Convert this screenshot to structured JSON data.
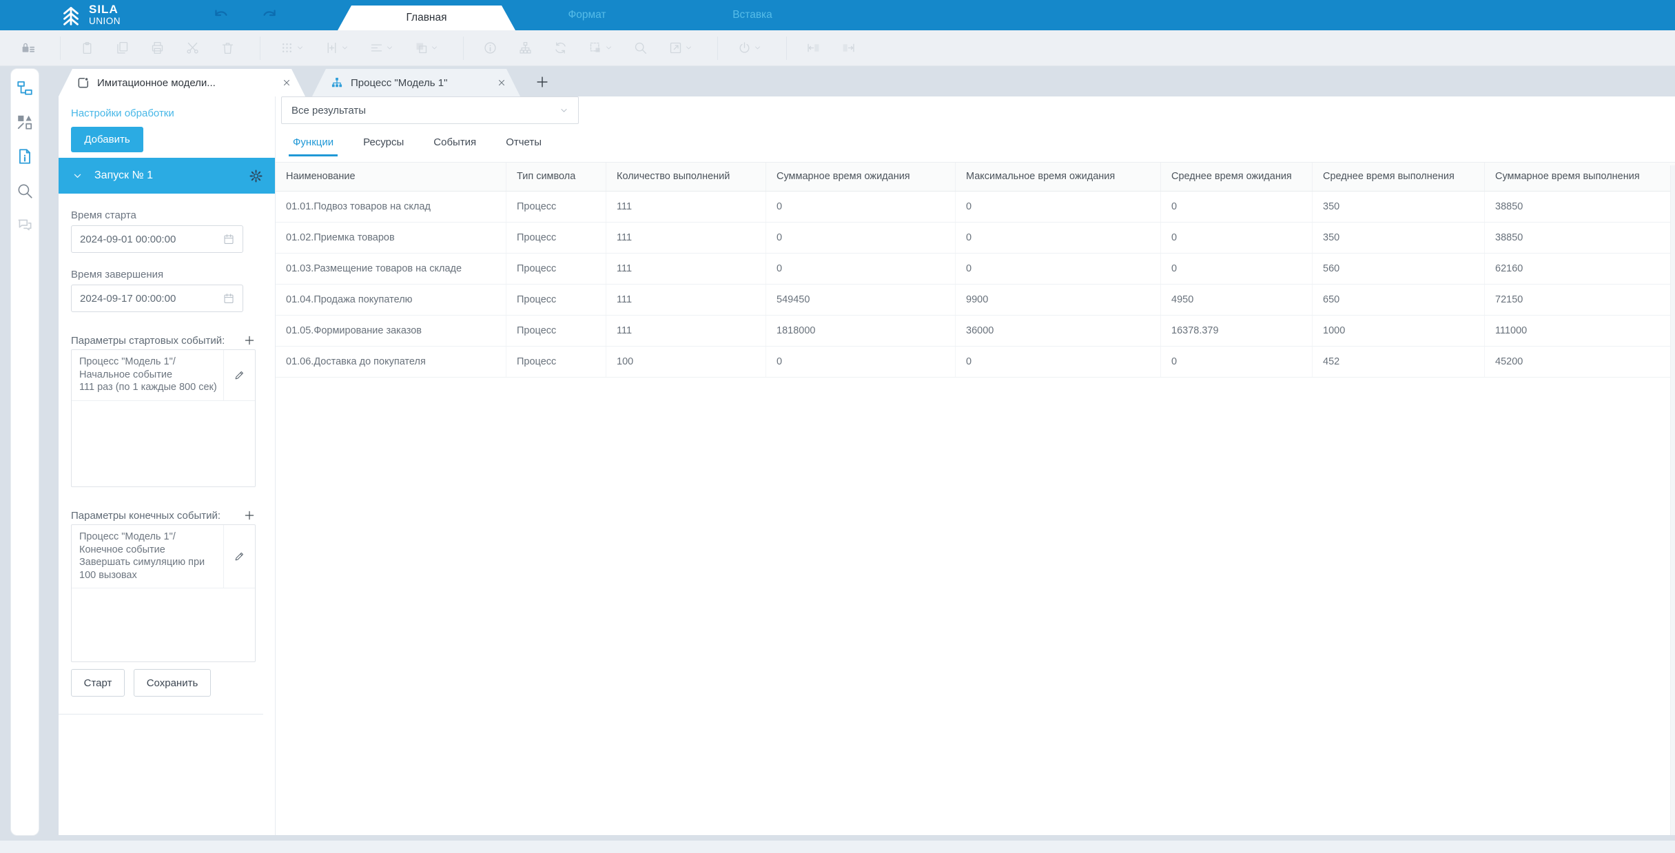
{
  "app": {
    "brand_line1": "SILA",
    "brand_line2": "UNION"
  },
  "colors": {
    "topbar_blue": "#1588ca",
    "accent_blue": "#2babe3",
    "tab_active_blue": "#2098d6",
    "link_blue": "#47b7e7"
  },
  "ribbon": {
    "tabs": [
      {
        "label": "Главная",
        "active": true
      },
      {
        "label": "Формат",
        "active": false
      },
      {
        "label": "Вставка",
        "active": false
      }
    ]
  },
  "toolbar": {
    "items": [
      {
        "icon": "lock-menu-icon",
        "enabled": true
      },
      {
        "sep": true
      },
      {
        "icon": "paste-icon"
      },
      {
        "icon": "copy-icon"
      },
      {
        "icon": "print-icon"
      },
      {
        "icon": "cut-icon"
      },
      {
        "icon": "delete-icon"
      },
      {
        "sep": true
      },
      {
        "icon": "grid-icon",
        "chevron": true
      },
      {
        "icon": "insert-symbol-icon",
        "chevron": true
      },
      {
        "icon": "align-icon",
        "chevron": true
      },
      {
        "icon": "layers-icon",
        "chevron": true
      },
      {
        "sep": true
      },
      {
        "icon": "info-icon"
      },
      {
        "icon": "hierarchy-icon"
      },
      {
        "icon": "refresh-icon"
      },
      {
        "icon": "selection-icon",
        "chevron": true
      },
      {
        "icon": "search-icon"
      },
      {
        "icon": "open-diagram-icon",
        "chevron": true
      },
      {
        "sep": true
      },
      {
        "icon": "power-icon",
        "chevron": true
      },
      {
        "sep": true
      },
      {
        "icon": "collapse-left-icon"
      },
      {
        "icon": "collapse-right-icon"
      }
    ]
  },
  "dock": {
    "items": [
      {
        "icon": "model-tree-icon"
      },
      {
        "icon": "shapes-icon"
      },
      {
        "icon": "document-info-icon"
      },
      {
        "icon": "search-icon"
      },
      {
        "icon": "comments-icon"
      }
    ]
  },
  "doc_tabs": [
    {
      "label": "Имитационное модели...",
      "icon": "report-icon",
      "active": true
    },
    {
      "label": "Процесс \"Модель 1\"",
      "icon": "org-chart-icon",
      "active": false
    }
  ],
  "panel": {
    "settings_link": "Настройки обработки",
    "add_button": "Добавить",
    "run_header": "Запуск № 1",
    "start_time_label": "Время старта",
    "start_time_value": "2024-09-01 00:00:00",
    "end_time_label": "Время завершения",
    "end_time_value": "2024-09-17 00:00:00",
    "start_events_label": "Параметры стартовых событий:",
    "start_events_text": "Процесс \"Модель 1\"/\nНачальное событие\n111 раз (по 1 каждые 800 сек)",
    "end_events_label": "Параметры конечных событий:",
    "end_events_text": "Процесс \"Модель 1\"/\nКонечное событие\nЗавершать симуляцию при 100 вызовах",
    "start_button": "Старт",
    "save_button": "Сохранить"
  },
  "results": {
    "filter_value": "Все результаты",
    "tabs": [
      "Функции",
      "Ресурсы",
      "События",
      "Отчеты"
    ],
    "active_tab": "Функции"
  },
  "table": {
    "columns": [
      "Наименование",
      "Тип символа",
      "Количество выполнений",
      "Суммарное время ожидания",
      "Максимальное время ожидания",
      "Среднее время ожидания",
      "Среднее время выполнения",
      "Суммарное время выполнения"
    ],
    "rows": [
      [
        "01.01.Подвоз товаров на склад",
        "Процесс",
        "111",
        "0",
        "0",
        "0",
        "350",
        "38850"
      ],
      [
        "01.02.Приемка товаров",
        "Процесс",
        "111",
        "0",
        "0",
        "0",
        "350",
        "38850"
      ],
      [
        "01.03.Размещение товаров на складе",
        "Процесс",
        "111",
        "0",
        "0",
        "0",
        "560",
        "62160"
      ],
      [
        "01.04.Продажа покупателю",
        "Процесс",
        "111",
        "549450",
        "9900",
        "4950",
        "650",
        "72150"
      ],
      [
        "01.05.Формирование заказов",
        "Процесс",
        "111",
        "1818000",
        "36000",
        "16378.379",
        "1000",
        "111000"
      ],
      [
        "01.06.Доставка до покупателя",
        "Процесс",
        "100",
        "0",
        "0",
        "0",
        "452",
        "45200"
      ]
    ]
  }
}
